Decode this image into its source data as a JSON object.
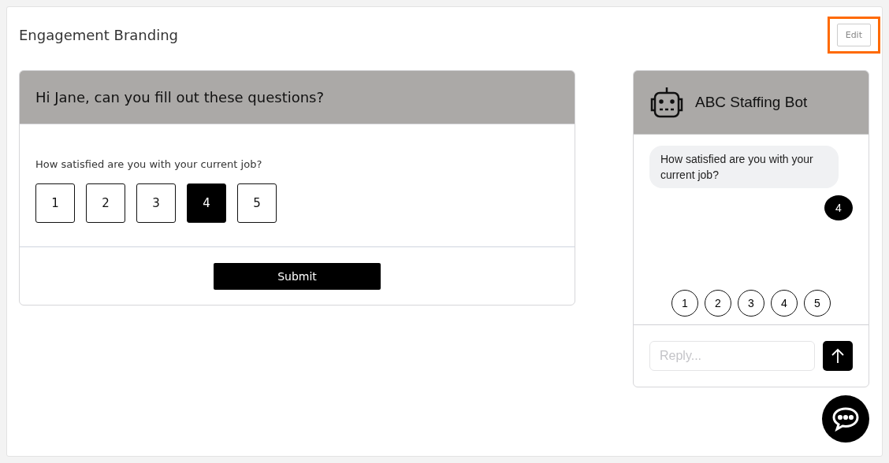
{
  "page": {
    "title": "Engagement Branding"
  },
  "edit_button": {
    "label": "Edit",
    "highlighted": true
  },
  "survey": {
    "heading": "Hi Jane, can you fill out these questions?",
    "question": "How satisfied are you with your current job?",
    "options": [
      {
        "label": "1",
        "selected": false
      },
      {
        "label": "2",
        "selected": false
      },
      {
        "label": "3",
        "selected": false
      },
      {
        "label": "4",
        "selected": true
      },
      {
        "label": "5",
        "selected": false
      }
    ],
    "submit": "Submit"
  },
  "chat": {
    "bot_name": "ABC Staffing Bot",
    "messages": [
      {
        "kind": "bot",
        "text": "How satisfied are you with your current job?"
      },
      {
        "kind": "user",
        "text": "4"
      }
    ],
    "quick_replies": [
      "1",
      "2",
      "3",
      "4",
      "5"
    ],
    "reply_placeholder": "Reply..."
  }
}
